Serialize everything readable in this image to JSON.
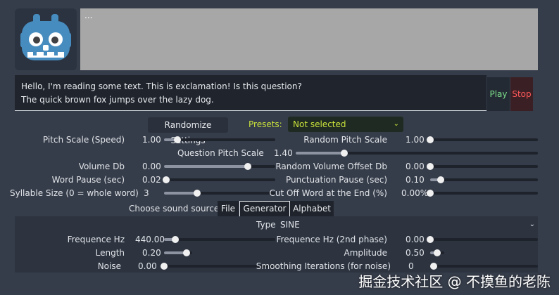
{
  "output_box": {
    "text": "..."
  },
  "input": {
    "line1": "Hello, I'm reading some text. This is exclamation! Is this question?",
    "line2": "The quick brown fox jumps over the lazy dog."
  },
  "buttons": {
    "play": "Play",
    "stop": "Stop",
    "randomize": "Randomize Settings"
  },
  "presets": {
    "label": "Presets:",
    "selected": "Not selected"
  },
  "params": {
    "pitch_scale": {
      "label": "Pitch Scale (Speed)",
      "value": "1.00",
      "level": 0.12
    },
    "random_pitch": {
      "label": "Random Pitch Scale",
      "value": "1.00",
      "level": 0.0
    },
    "question_pitch": {
      "label": "Question Pitch Scale",
      "value": "1.40",
      "level": 0.2
    },
    "volume_db": {
      "label": "Volume Db",
      "value": "0.00",
      "level": 0.75
    },
    "random_volume": {
      "label": "Random Volume Offset Db",
      "value": "0.00",
      "level": 0.0
    },
    "word_pause": {
      "label": "Word Pause (sec)",
      "value": "0.02",
      "level": 0.02
    },
    "punctuation_pause": {
      "label": "Punctuation Pause (sec)",
      "value": "0.10",
      "level": 0.1
    },
    "syllable_size": {
      "label": "Syllable Size (0 = whole word)",
      "value": "3",
      "level": 0.3
    },
    "cut_off": {
      "label": "Cut Off Word at the End (%)",
      "value": "0.00%",
      "level": 0.0
    }
  },
  "sound_source": {
    "label": "Choose sound source:",
    "tabs": [
      "File",
      "Generator",
      "Alphabet"
    ],
    "active_tab": "Generator"
  },
  "generator": {
    "type_label": "Type",
    "type_value": "SINE",
    "frequence": {
      "label": "Frequence Hz",
      "value": "440.00",
      "level": 0.1
    },
    "frequence2": {
      "label": "Frequence Hz (2nd phase)",
      "value": "0.00",
      "level": 0.0
    },
    "length": {
      "label": "Length",
      "value": "0.20",
      "level": 0.8
    },
    "amplitude": {
      "label": "Amplitude",
      "value": "0.50",
      "level": 0.5
    },
    "noise": {
      "label": "Noise",
      "value": "0.00",
      "level": 0.0
    },
    "smoothing": {
      "label": "Smoothing Iterations (for noise)",
      "value": "0",
      "level": 0.0
    }
  },
  "watermark": "掘金技术社区 @ 不摸鱼的老陈",
  "colors": {
    "play": "#7ddf8c",
    "stop": "#ff5a5a",
    "presets": "#c9e23b",
    "background": "#363d4a"
  }
}
